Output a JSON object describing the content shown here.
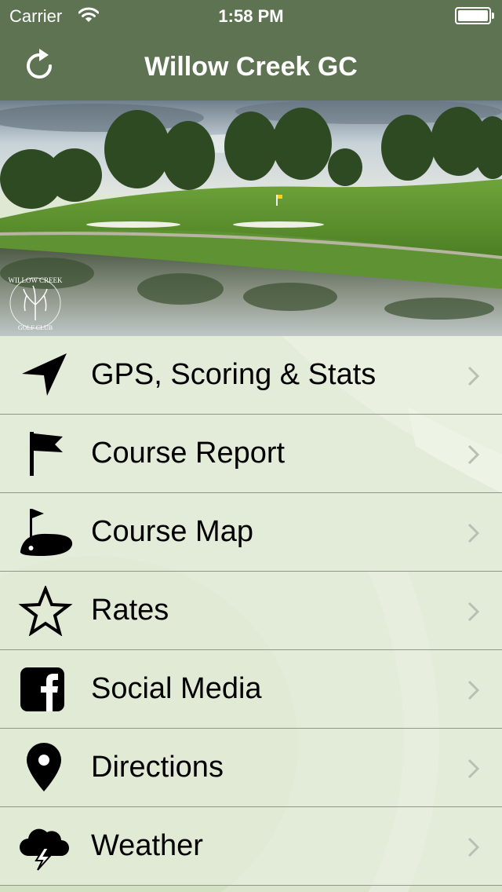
{
  "status_bar": {
    "carrier": "Carrier",
    "time": "1:58 PM",
    "battery_level": 1.0
  },
  "nav": {
    "title": "Willow Creek GC",
    "refresh_icon": "refresh-icon"
  },
  "hero": {
    "logo_top": "WILLOW CREEK",
    "logo_bottom": "GOLF CLUB"
  },
  "menu": {
    "items": [
      {
        "label": "GPS, Scoring & Stats",
        "icon": "navigation-arrow-icon"
      },
      {
        "label": "Course Report",
        "icon": "flag-icon"
      },
      {
        "label": "Course Map",
        "icon": "golf-green-icon"
      },
      {
        "label": "Rates",
        "icon": "star-icon"
      },
      {
        "label": "Social Media",
        "icon": "facebook-icon"
      },
      {
        "label": "Directions",
        "icon": "map-pin-icon"
      },
      {
        "label": "Weather",
        "icon": "storm-cloud-icon"
      }
    ]
  },
  "colors": {
    "nav_bar": "#5d7352",
    "row_background": "#e8f0de",
    "row_divider": "#8e9a86",
    "chevron": "#b9c0b3"
  }
}
